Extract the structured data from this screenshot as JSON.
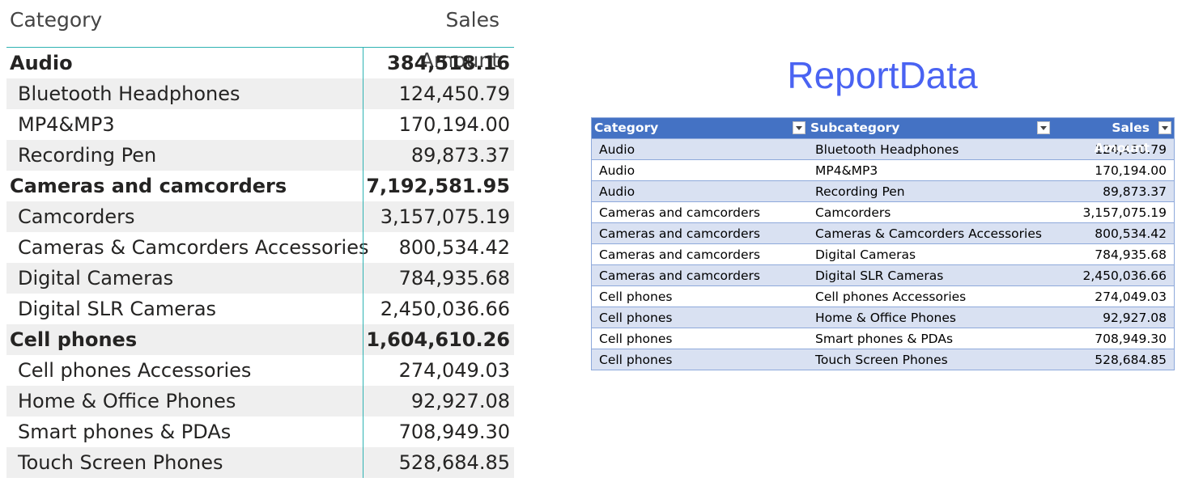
{
  "matrix": {
    "header": {
      "category": "Category",
      "amount": "Sales Amount"
    },
    "rows": [
      {
        "label": "Audio",
        "amount": "384,518.16",
        "type": "group"
      },
      {
        "label": "Bluetooth Headphones",
        "amount": "124,450.79",
        "type": "child"
      },
      {
        "label": "MP4&MP3",
        "amount": "170,194.00",
        "type": "child"
      },
      {
        "label": "Recording Pen",
        "amount": "89,873.37",
        "type": "child"
      },
      {
        "label": "Cameras and camcorders",
        "amount": "7,192,581.95",
        "type": "group"
      },
      {
        "label": "Camcorders",
        "amount": "3,157,075.19",
        "type": "child"
      },
      {
        "label": "Cameras & Camcorders Accessories",
        "amount": "800,534.42",
        "type": "child"
      },
      {
        "label": "Digital Cameras",
        "amount": "784,935.68",
        "type": "child"
      },
      {
        "label": "Digital SLR Cameras",
        "amount": "2,450,036.66",
        "type": "child"
      },
      {
        "label": "Cell phones",
        "amount": "1,604,610.26",
        "type": "group"
      },
      {
        "label": "Cell phones Accessories",
        "amount": "274,049.03",
        "type": "child"
      },
      {
        "label": "Home & Office Phones",
        "amount": "92,927.08",
        "type": "child"
      },
      {
        "label": "Smart phones & PDAs",
        "amount": "708,949.30",
        "type": "child"
      },
      {
        "label": "Touch Screen Phones",
        "amount": "528,684.85",
        "type": "child"
      }
    ]
  },
  "report": {
    "title": "ReportData",
    "header": {
      "category": "Category",
      "subcategory": "Subcategory",
      "amount": "Sales Amount"
    },
    "rows": [
      {
        "category": "Audio",
        "subcategory": "Bluetooth Headphones",
        "amount": "124,450.79"
      },
      {
        "category": "Audio",
        "subcategory": "MP4&MP3",
        "amount": "170,194.00"
      },
      {
        "category": "Audio",
        "subcategory": "Recording Pen",
        "amount": "89,873.37"
      },
      {
        "category": "Cameras and camcorders",
        "subcategory": "Camcorders",
        "amount": "3,157,075.19"
      },
      {
        "category": "Cameras and camcorders",
        "subcategory": "Cameras & Camcorders Accessories",
        "amount": "800,534.42"
      },
      {
        "category": "Cameras and camcorders",
        "subcategory": "Digital Cameras",
        "amount": "784,935.68"
      },
      {
        "category": "Cameras and camcorders",
        "subcategory": "Digital SLR Cameras",
        "amount": "2,450,036.66"
      },
      {
        "category": "Cell phones",
        "subcategory": "Cell phones Accessories",
        "amount": "274,049.03"
      },
      {
        "category": "Cell phones",
        "subcategory": "Home & Office Phones",
        "amount": "92,927.08"
      },
      {
        "category": "Cell phones",
        "subcategory": "Smart phones & PDAs",
        "amount": "708,949.30"
      },
      {
        "category": "Cell phones",
        "subcategory": "Touch Screen Phones",
        "amount": "528,684.85"
      }
    ]
  },
  "colors": {
    "accent_line": "#2fb3b3",
    "title": "#4a63f2",
    "table_header": "#4472c4",
    "table_band": "#d9e1f2",
    "matrix_alt_row": "#efefef"
  },
  "icons": {
    "filter": "filter-dropdown-icon"
  }
}
